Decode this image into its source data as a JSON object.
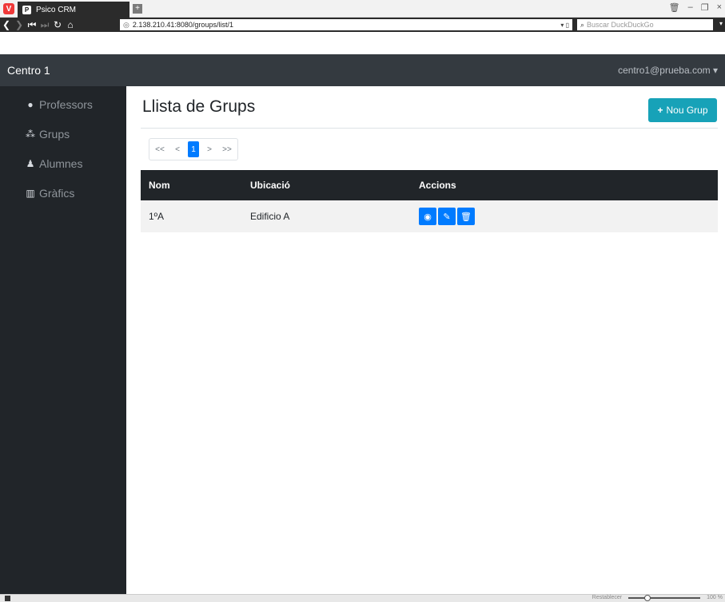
{
  "browser": {
    "tab_title": "Psico CRM",
    "url": "2.138.210.41:8080/groups/list/1",
    "search_placeholder": "Buscar DuckDuckGo",
    "zoom_label": "Restablecer",
    "zoom_value": "100 %"
  },
  "navbar": {
    "brand": "Centro 1",
    "user_email": "centro1@prueba.com"
  },
  "sidebar": {
    "items": [
      {
        "label": "Professors",
        "icon": "user-icon"
      },
      {
        "label": "Grups",
        "icon": "users-icon"
      },
      {
        "label": "Alumnes",
        "icon": "child-icon"
      },
      {
        "label": "Gràfics",
        "icon": "chart-icon"
      }
    ]
  },
  "main": {
    "title": "Llista de Grups",
    "new_button": "Nou Grup",
    "pagination": [
      "<<",
      "<",
      "1",
      ">",
      ">>"
    ],
    "active_page": "1",
    "table": {
      "headers": [
        "Nom",
        "Ubicació",
        "Accions"
      ],
      "rows": [
        {
          "nom": "1ºA",
          "ubicacio": "Edificio A"
        }
      ]
    }
  }
}
